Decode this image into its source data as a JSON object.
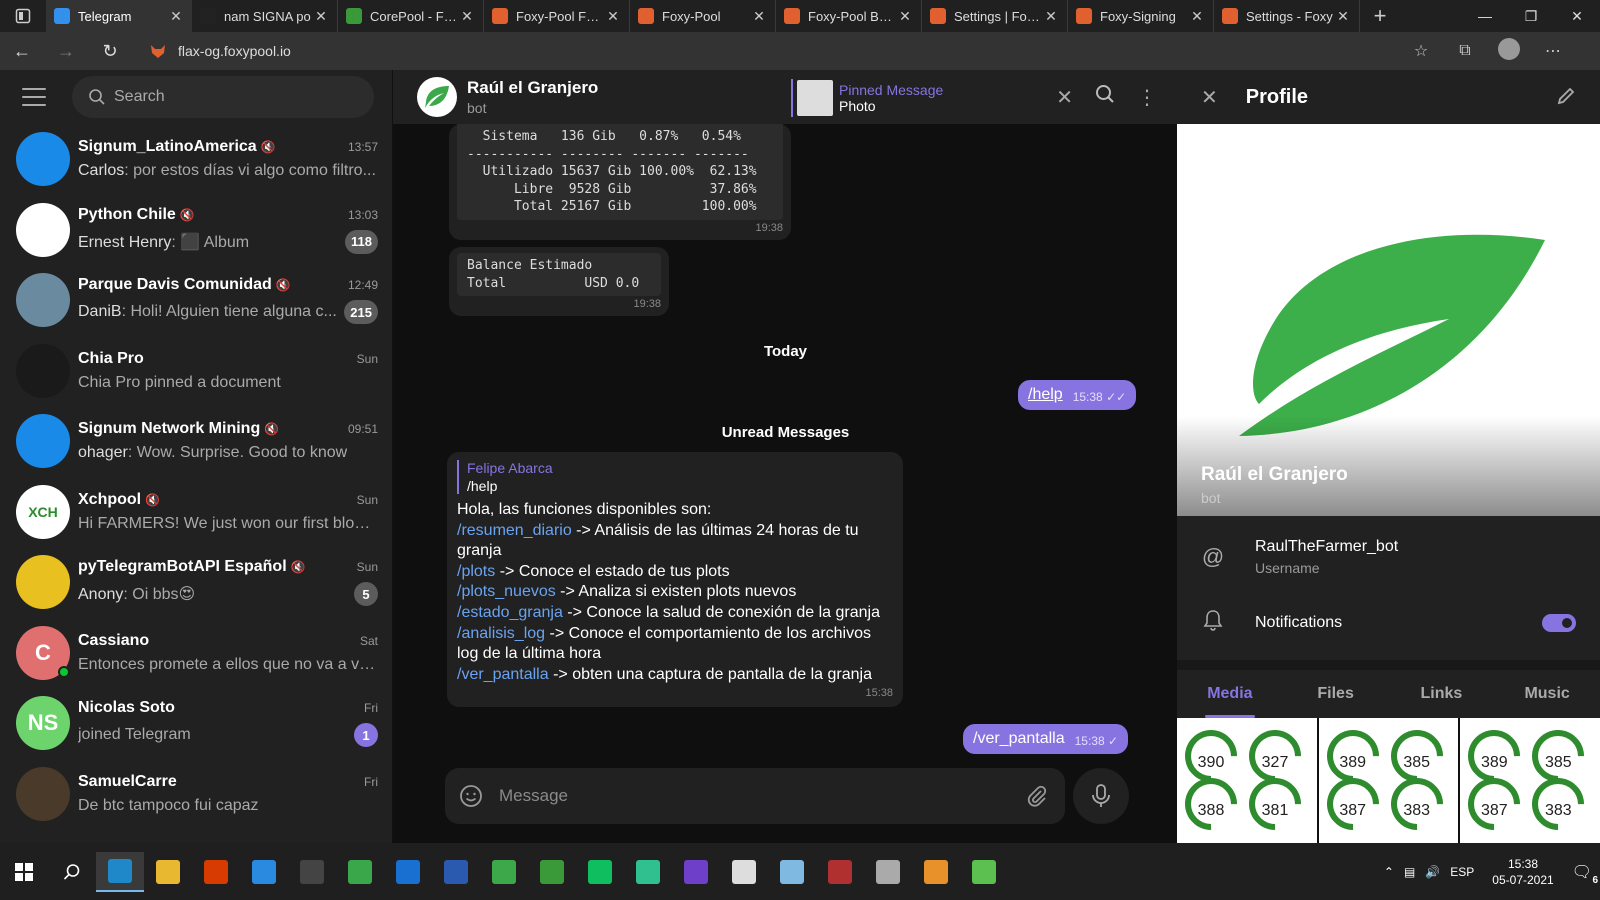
{
  "browser": {
    "tabs": [
      {
        "label": "Telegram",
        "color": "#3390ec",
        "active": true
      },
      {
        "label": "nam SIGNA po",
        "color": "#222"
      },
      {
        "label": "CorePool - Farm",
        "color": "#3a9a3a"
      },
      {
        "label": "Foxy-Pool FLAX",
        "color": "#e06030"
      },
      {
        "label": "Foxy-Pool",
        "color": "#e06030"
      },
      {
        "label": "Foxy-Pool BHD",
        "color": "#e06030"
      },
      {
        "label": "Settings | Foxy-",
        "color": "#e06030"
      },
      {
        "label": "Foxy-Signing",
        "color": "#e06030"
      },
      {
        "label": "Settings - Foxy",
        "color": "#e06030"
      }
    ],
    "url": "flax-og.foxypool.io"
  },
  "sidebar": {
    "search_placeholder": "Search",
    "chats": [
      {
        "name": "Signum_LatinoAmerica",
        "muted": true,
        "time": "13:57",
        "sender": "Carlos",
        "message": "por estos días vi algo como filtro...",
        "badge": "",
        "avatar_color": "#1a8ae8",
        "initials": ""
      },
      {
        "name": "Python Chile",
        "muted": true,
        "time": "13:03",
        "sender": "Ernest Henry",
        "message": "⬛ Album",
        "badge": "118",
        "avatar_color": "#fff",
        "initials": ""
      },
      {
        "name": "Parque Davis Comunidad",
        "muted": true,
        "time": "12:49",
        "sender": "DaniB",
        "message": "Holi! Alguien tiene alguna c...",
        "badge": "215",
        "avatar_color": "#6a8aa0",
        "initials": ""
      },
      {
        "name": "Chia Pro",
        "muted": false,
        "time": "Sun",
        "sender": "",
        "message": "Chia Pro pinned a document",
        "badge": "",
        "avatar_color": "#1a1a1a",
        "initials": ""
      },
      {
        "name": "Signum Network Mining",
        "muted": true,
        "time": "09:51",
        "sender": "ohager",
        "message": "Wow. Surprise. Good to know",
        "badge": "",
        "avatar_color": "#1a8ae8",
        "initials": ""
      },
      {
        "name": "Xchpool",
        "muted": true,
        "time": "Sun",
        "sender": "",
        "message": "Hi FARMERS! We just won our first block...",
        "badge": "",
        "avatar_color": "#fff",
        "initials": "XCH"
      },
      {
        "name": "pyTelegramBotAPI Español",
        "muted": true,
        "time": "Sun",
        "sender": "Anony",
        "message": "Oi bbs😍",
        "badge": "5",
        "avatar_color": "#e8c020",
        "initials": ""
      },
      {
        "name": "Cassiano",
        "muted": false,
        "time": "Sat",
        "sender": "",
        "message": "Entonces promete a ellos que no va a ve...",
        "badge": "",
        "avatar_color": "#e07070",
        "initials": "C",
        "online": true
      },
      {
        "name": "Nicolas Soto",
        "muted": false,
        "time": "Fri",
        "sender": "",
        "message": "joined Telegram",
        "badge": "1",
        "badge_purple": true,
        "avatar_color": "#6dd46d",
        "initials": "NS"
      },
      {
        "name": "SamuelCarre",
        "muted": false,
        "time": "Fri",
        "sender": "",
        "message": "De btc tampoco fui capaz",
        "badge": "",
        "avatar_color": "#4a3a2a",
        "initials": ""
      }
    ]
  },
  "chat": {
    "title": "Raúl el Granjero",
    "subtitle": "bot",
    "pinned_label": "Pinned Message",
    "pinned_text": "Photo",
    "table_text": "  Sistema   136 Gib   0.87%   0.54%\n----------- -------- ------- -------\n  Utilizado 15637 Gib 100.00%  62.13%\n      Libre  9528 Gib          37.86%\n      Total 25167 Gib         100.00%",
    "table_time": "19:38",
    "balance_text": "Balance Estimado\nTotal          USD 0.0",
    "balance_time": "19:38",
    "sep_today": "Today",
    "help_cmd": "/help",
    "help_time": "15:38",
    "sep_unread": "Unread Messages",
    "reply_name": "Felipe Abarca",
    "reply_text": "/help",
    "bot_intro": "Hola, las funciones disponibles son:",
    "commands": [
      {
        "cmd": "/resumen_diario",
        "desc": " -> Análisis de las últimas 24 horas de tu granja"
      },
      {
        "cmd": "/plots",
        "desc": " -> Conoce el estado de tus plots"
      },
      {
        "cmd": "/plots_nuevos",
        "desc": " -> Analiza si existen plots nuevos"
      },
      {
        "cmd": "/estado_granja",
        "desc": " -> Conoce la salud de conexión de la granja"
      },
      {
        "cmd": "/analisis_log",
        "desc": " -> Conoce el comportamiento de los archivos log de la última hora"
      },
      {
        "cmd": "/ver_pantalla",
        "desc": " -> obten una captura de pantalla de la granja"
      }
    ],
    "bot_time": "15:38",
    "ver_cmd": "/ver_pantalla",
    "ver_time": "15:38",
    "composer_placeholder": "Message"
  },
  "profile": {
    "title": "Profile",
    "name": "Raúl el Granjero",
    "role": "bot",
    "username": "RaulTheFarmer_bot",
    "username_label": "Username",
    "notifications_label": "Notifications",
    "notifications_on": true,
    "tabs": [
      "Media",
      "Files",
      "Links",
      "Music"
    ],
    "media_values": [
      [
        "390",
        "327",
        "388",
        "381"
      ],
      [
        "389",
        "385",
        "387",
        "383"
      ],
      [
        "389",
        "385",
        "387",
        "383"
      ]
    ]
  },
  "taskbar": {
    "lang": "ESP",
    "time": "15:38",
    "date": "05-07-2021",
    "notif_count": "6"
  }
}
